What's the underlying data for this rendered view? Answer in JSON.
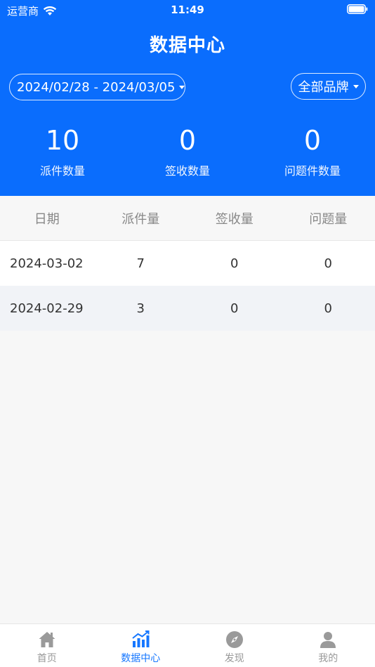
{
  "status_bar": {
    "carrier": "运营商",
    "time": "11:49"
  },
  "header": {
    "title": "数据中心",
    "date_range": "2024/02/28 - 2024/03/05",
    "brand_filter": "全部品牌"
  },
  "stats": [
    {
      "value": "10",
      "label": "派件数量"
    },
    {
      "value": "0",
      "label": "签收数量"
    },
    {
      "value": "0",
      "label": "问题件数量"
    }
  ],
  "table": {
    "columns": [
      "日期",
      "派件量",
      "签收量",
      "问题量"
    ],
    "rows": [
      [
        "2024-03-02",
        "7",
        "0",
        "0"
      ],
      [
        "2024-02-29",
        "3",
        "0",
        "0"
      ]
    ]
  },
  "tabbar": {
    "items": [
      {
        "label": "首页",
        "icon": "home-icon"
      },
      {
        "label": "数据中心",
        "icon": "chart-icon"
      },
      {
        "label": "发现",
        "icon": "compass-icon"
      },
      {
        "label": "我的",
        "icon": "user-icon"
      }
    ]
  },
  "colors": {
    "primary": "#0a6dfd",
    "active_tab": "#1677ff",
    "inactive_tab": "#999999"
  }
}
